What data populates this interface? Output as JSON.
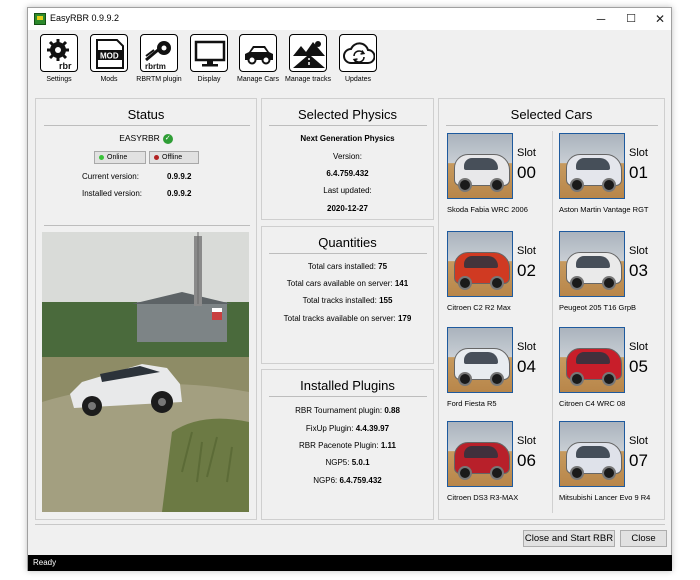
{
  "window": {
    "title": "EasyRBR 0.9.9.2",
    "minimize": "─",
    "maximize": "☐",
    "close": "✕"
  },
  "toolbar": [
    {
      "label": "Settings"
    },
    {
      "label": "Mods"
    },
    {
      "label": "RBRTM plugin"
    },
    {
      "label": "Display"
    },
    {
      "label": "Manage Cars"
    },
    {
      "label": "Manage tracks"
    },
    {
      "label": "Updates"
    }
  ],
  "icons": {
    "settings": "rbr",
    "mods": "MOD",
    "rbrtm": "rbrtm"
  },
  "status": {
    "title": "Status",
    "app_name": "EASYRBR",
    "online_label": "Online",
    "offline_label": "Offline",
    "online_color": "#39c239",
    "offline_color": "#b22222",
    "current_version_label": "Current version:",
    "current_version": "0.9.9.2",
    "installed_version_label": "Installed version:",
    "installed_version": "0.9.9.2"
  },
  "physics": {
    "title": "Selected Physics",
    "name": "Next Generation Physics",
    "version_label": "Version:",
    "version": "6.4.759.432",
    "updated_label": "Last updated:",
    "updated": "2020-12-27"
  },
  "quantities": {
    "title": "Quantities",
    "rows": [
      {
        "label": "Total cars installed:",
        "value": "75"
      },
      {
        "label": "Total cars available on server:",
        "value": "141"
      },
      {
        "label": "Total tracks installed:",
        "value": "155"
      },
      {
        "label": "Total tracks available on server:",
        "value": "179"
      }
    ]
  },
  "plugins": {
    "title": "Installed Plugins",
    "rows": [
      {
        "label": "RBR Tournament plugin:",
        "value": "0.88"
      },
      {
        "label": "FixUp Plugin:",
        "value": "4.4.39.97"
      },
      {
        "label": "RBR Pacenote Plugin:",
        "value": "1.11"
      },
      {
        "label": "NGP5:",
        "value": "5.0.1"
      },
      {
        "label": "NGP6:",
        "value": "6.4.759.432"
      }
    ]
  },
  "cars": {
    "title": "Selected Cars",
    "slot_word": "Slot",
    "slots": [
      {
        "num": "00",
        "name": "Skoda Fabia WRC 2006",
        "color": "#e8e8ea"
      },
      {
        "num": "01",
        "name": "Aston Martin Vantage RGT",
        "color": "#e4e6ec"
      },
      {
        "num": "02",
        "name": "Citroen C2 R2 Max",
        "color": "#d03a22"
      },
      {
        "num": "03",
        "name": "Peugeot 205 T16 GrpB",
        "color": "#eaeaea"
      },
      {
        "num": "04",
        "name": "Ford Fiesta R5",
        "color": "#e8ecf0"
      },
      {
        "num": "05",
        "name": "Citroen C4 WRC 08",
        "color": "#c81e2a"
      },
      {
        "num": "06",
        "name": "Citroen DS3 R3-MAX",
        "color": "#b8202a"
      },
      {
        "num": "07",
        "name": "Mitsubishi Lancer Evo 9 R4",
        "color": "#dfe2ea"
      }
    ]
  },
  "buttons": {
    "start": "Close and Start RBR",
    "close": "Close"
  },
  "statusbar": {
    "text": "Ready"
  }
}
